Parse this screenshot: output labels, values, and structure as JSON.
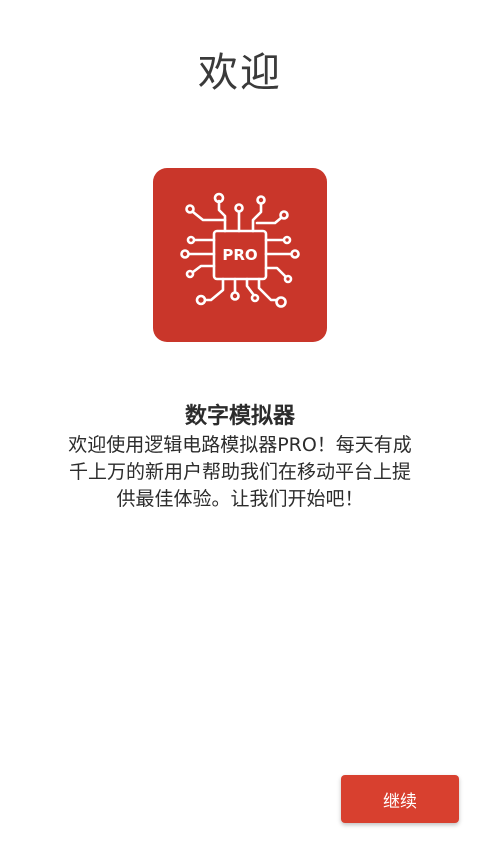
{
  "welcome": {
    "title": "欢迎",
    "app_name": "数字模拟器",
    "description": "欢迎使用逻辑电路模拟器PRO！每天有成千上万的新用户帮助我们在移动平台上提供最佳体验。让我们开始吧！",
    "continue_label": "继续"
  },
  "logo": {
    "chip_label": "PRO",
    "background_color": "#c9362a",
    "icon": "circuit-chip-icon"
  },
  "colors": {
    "accent": "#d8402f"
  }
}
